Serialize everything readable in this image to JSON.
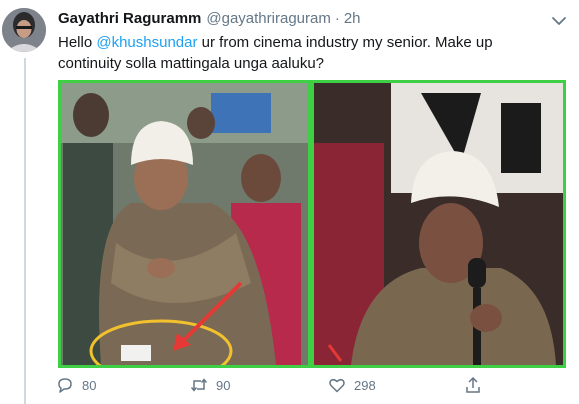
{
  "tweet": {
    "author_name": "Gayathri Raguramm",
    "author_handle": "@gayathriraguram",
    "separator": "·",
    "time": "2h",
    "text_greeting": "Hello ",
    "mention": "@khushsundar",
    "text_body": " ur from cinema industry my senior. Make up continuity solla mattingala unga aaluku?"
  },
  "actions": {
    "reply_count": "80",
    "retweet_count": "90",
    "like_count": "298"
  },
  "icons": {
    "reply": "reply-bubble-icon",
    "retweet": "retweet-arrows-icon",
    "like": "heart-icon",
    "share": "share-upload-icon",
    "more": "chevron-down-icon"
  },
  "colors": {
    "link": "#1da1f2",
    "muted": "#657786",
    "image_border": "#3fcf45",
    "annotation_circle": "#f2c12e",
    "annotation_arrow": "#e53935"
  }
}
